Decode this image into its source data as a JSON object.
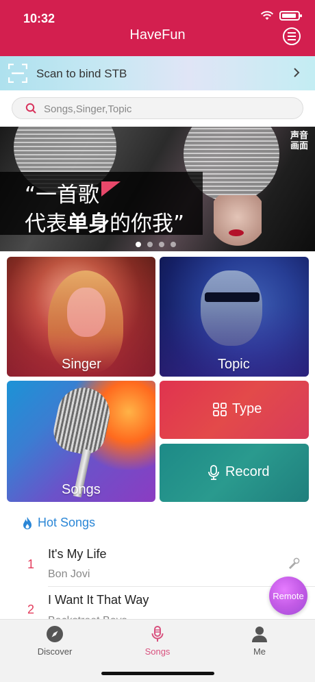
{
  "status": {
    "time": "10:32"
  },
  "nav": {
    "title": "HaveFun"
  },
  "scan": {
    "label": "Scan to bind STB"
  },
  "search": {
    "placeholder": "Songs,Singer,Topic"
  },
  "banner": {
    "line1": "“一首歌",
    "line2_pre": "代表",
    "line2_bold": "单身",
    "line2_post": "的你我”",
    "logo_text": "声音 画面",
    "dots": 4,
    "active_dot": 0
  },
  "tiles": {
    "singer": "Singer",
    "topic": "Topic",
    "songs": "Songs",
    "type": "Type",
    "record": "Record"
  },
  "hot": {
    "title": "Hot Songs",
    "songs": [
      {
        "rank": "1",
        "title": "It's My Life",
        "artist": "Bon Jovi"
      },
      {
        "rank": "2",
        "title": "I Want It That Way",
        "artist": "Backstreet Boys"
      }
    ]
  },
  "remote": {
    "label": "Remote"
  },
  "tabs": [
    {
      "label": "Discover",
      "icon": "compass-icon"
    },
    {
      "label": "Songs",
      "icon": "microphone-icon"
    },
    {
      "label": "Me",
      "icon": "person-icon"
    }
  ],
  "colors": {
    "brand": "#d31f4f",
    "accent_blue": "#2a86d6",
    "active_tab": "#d8517e",
    "rank": "#e33c5c"
  }
}
